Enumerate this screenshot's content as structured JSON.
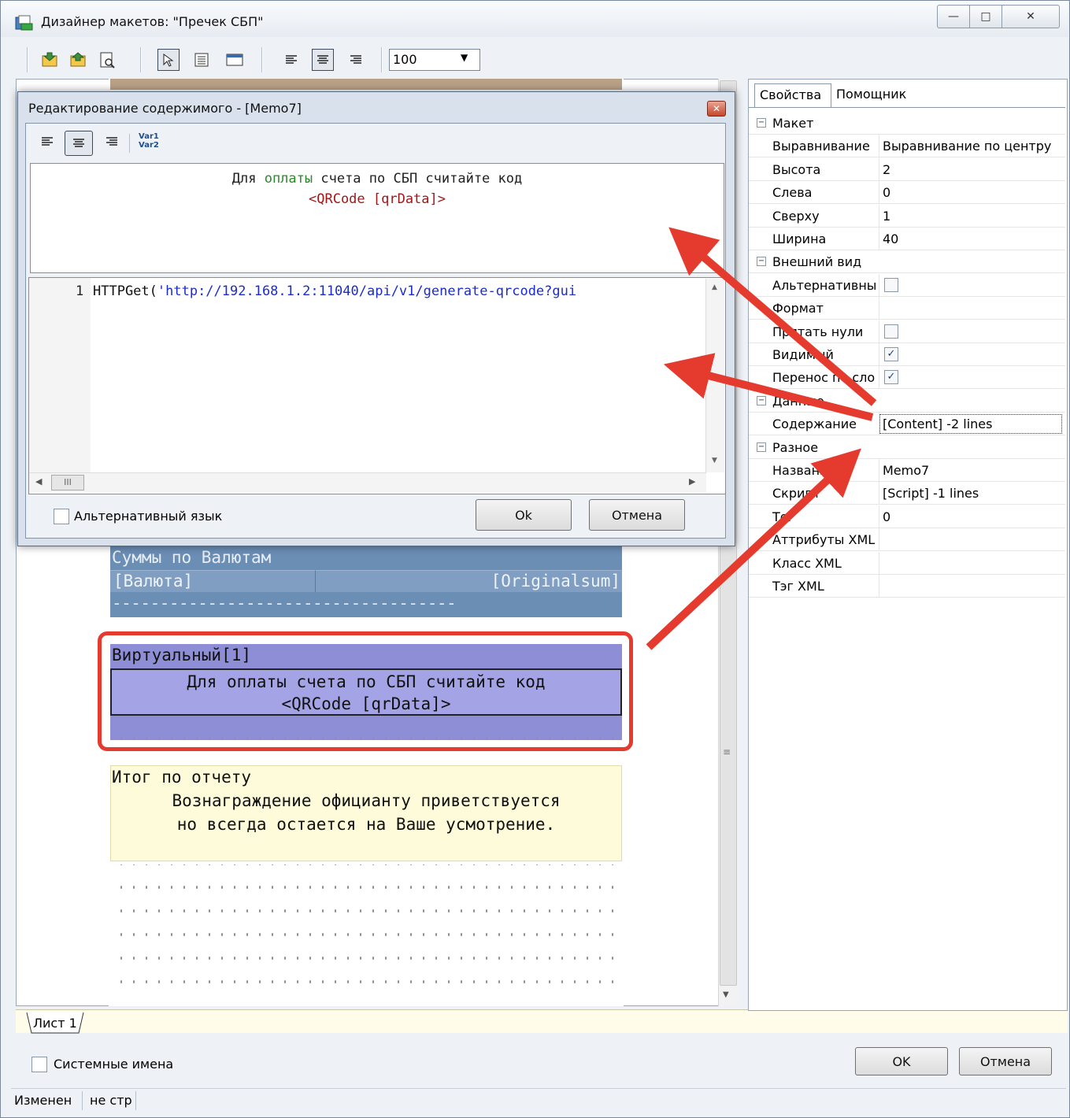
{
  "window": {
    "title": "Дизайнер макетов: \"Пречек СБП\"",
    "min_glyph": "—",
    "max_glyph": "□",
    "close_glyph": "✕"
  },
  "toolbar": {
    "zoom_value": "100"
  },
  "dialog": {
    "title": "Редактирование содержимого - [Memo7]",
    "var_label_1": "Var1",
    "var_label_2": "Var2",
    "preview_line1_a": "Для ",
    "preview_line1_b": "оплаты",
    "preview_line1_c": " счета по СБП считайте код",
    "preview_line2": "<QRCode [qrData]>",
    "editor_line_number": "1",
    "editor_code_func": "HTTPGet(",
    "editor_code_string": "'http://192.168.1.2:11040/api/v1/generate-qrcode?gui",
    "hscroll_thumb": "III",
    "alt_language_label": "Альтернативный язык",
    "ok_label": "Ok",
    "cancel_label": "Отмена"
  },
  "report": {
    "currency_header": "Суммы по Валютам",
    "currency_cell": "[Валюта]",
    "original_sum_cell": "[Originalsum]",
    "dash_line": "------------------------------------",
    "virtual_title": "Виртуальный[1]",
    "virtual_line1": "Для оплаты счета по СБП считайте код",
    "virtual_line2": "<QRCode [qrData]>",
    "total_title": "Итог по отчету",
    "total_line1": "Вознаграждение официанту приветствуется",
    "total_line2": "но всегда остается на Ваше усмотрение."
  },
  "sheet_tab": "Лист 1",
  "properties": {
    "tab_properties": "Свойства",
    "tab_helper": "Помощник",
    "rows": [
      {
        "type": "cat",
        "name": "Макет"
      },
      {
        "type": "prop",
        "name": "Выравнивание",
        "value": "Выравнивание по центру"
      },
      {
        "type": "prop",
        "name": "Высота",
        "value": "2"
      },
      {
        "type": "prop",
        "name": "Слева",
        "value": "0"
      },
      {
        "type": "prop",
        "name": "Сверху",
        "value": "1"
      },
      {
        "type": "prop",
        "name": "Ширина",
        "value": "40"
      },
      {
        "type": "cat",
        "name": "Внешний вид"
      },
      {
        "type": "check",
        "name": "Альтернативны",
        "checked": false
      },
      {
        "type": "prop",
        "name": "Формат",
        "value": ""
      },
      {
        "type": "check",
        "name": "Прятать нули",
        "checked": false
      },
      {
        "type": "check",
        "name": "Видимый",
        "checked": true
      },
      {
        "type": "check",
        "name": "Перенос по сло",
        "checked": true
      },
      {
        "type": "cat",
        "name": "Данные"
      },
      {
        "type": "prop",
        "name": "Содержание",
        "value": "[Content] -2 lines",
        "selected": true
      },
      {
        "type": "cat",
        "name": "Разное"
      },
      {
        "type": "prop",
        "name": "Название",
        "value": "Memo7"
      },
      {
        "type": "prop",
        "name": "Скрипт",
        "value": "[Script] -1 lines"
      },
      {
        "type": "prop",
        "name": "Тег",
        "value": "0"
      },
      {
        "type": "prop",
        "name": "Аттрибуты XML",
        "value": ""
      },
      {
        "type": "prop",
        "name": "Класс XML",
        "value": ""
      },
      {
        "type": "prop",
        "name": "Тэг XML",
        "value": ""
      }
    ]
  },
  "footer": {
    "system_names_label": "Системные имена",
    "ok_label": "OK",
    "cancel_label": "Отмена"
  },
  "status": {
    "left": "Изменен",
    "right": "не стр"
  },
  "colors": {
    "band_blue": "#6b8eb5",
    "band_purple": "#8e8ed6",
    "band_yellow": "#fdfbd9",
    "annotation_red": "#e43b2e",
    "keyword_green": "#2a8a2a",
    "qrcode_red": "#a01818",
    "code_blue": "#1c2ccc"
  }
}
